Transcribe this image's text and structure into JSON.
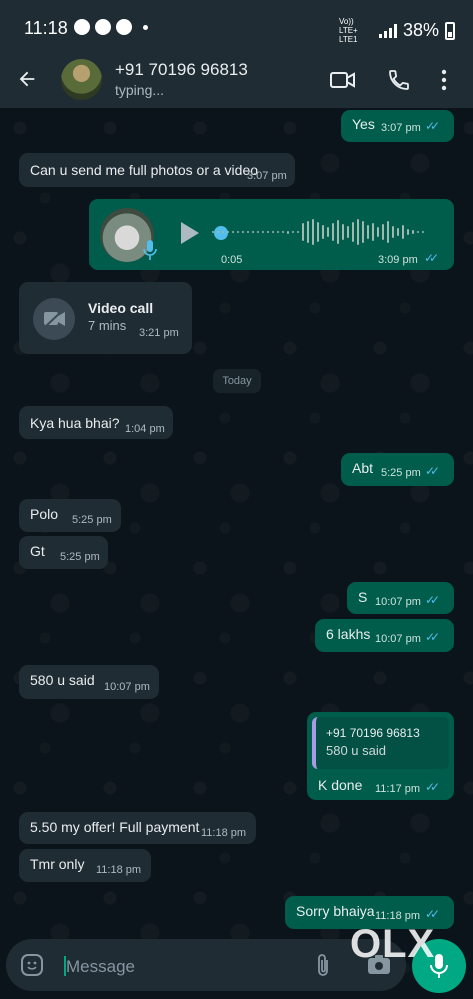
{
  "status_bar": {
    "time": "11:18",
    "network_label": "Vo)) LTE+ LTE1",
    "battery": "38%"
  },
  "header": {
    "contact_name": "+91 70196 96813",
    "status": "typing..."
  },
  "date_separator": "Today",
  "messages": [
    {
      "dir": "out",
      "text": "Yes",
      "time": "3:07 pm"
    },
    {
      "dir": "in",
      "text": "Can u send me full photos or a video",
      "time": "3:07 pm"
    },
    {
      "dir": "out",
      "type": "voice",
      "duration": "0:05",
      "time": "3:09 pm"
    },
    {
      "dir": "in",
      "type": "call",
      "title": "Video call",
      "detail": "7 mins",
      "time": "3:21 pm"
    },
    {
      "dir": "in",
      "text": "Kya hua bhai?",
      "time": "1:04 pm"
    },
    {
      "dir": "out",
      "text": "Abt",
      "time": "5:25 pm"
    },
    {
      "dir": "in",
      "text": "Polo",
      "time": "5:25 pm"
    },
    {
      "dir": "in",
      "text": "Gt",
      "time": "5:25 pm"
    },
    {
      "dir": "out",
      "text": "S",
      "time": "10:07 pm"
    },
    {
      "dir": "out",
      "text": "6 lakhs",
      "time": "10:07 pm"
    },
    {
      "dir": "in",
      "text": "580 u said",
      "time": "10:07 pm"
    },
    {
      "dir": "out",
      "type": "reply",
      "quoted_author": "+91 70196 96813",
      "quoted_text": "580 u said",
      "text": "K done",
      "time": "11:17 pm"
    },
    {
      "dir": "in",
      "text": "5.50 my offer! Full payment",
      "time": "11:18 pm"
    },
    {
      "dir": "in",
      "text": "Tmr only",
      "time": "11:18 pm"
    },
    {
      "dir": "out",
      "text": "Sorry bhaiya",
      "time": "11:18 pm"
    }
  ],
  "composer": {
    "placeholder": "Message"
  },
  "watermark": "OLX",
  "colors": {
    "incoming": "#202c33",
    "outgoing": "#005c4b",
    "accent": "#00a884",
    "read_ticks": "#53bdeb"
  },
  "icons": [
    "back-arrow-icon",
    "video-call-icon",
    "phone-icon",
    "more-icon",
    "emoji-icon",
    "attach-icon",
    "camera-icon",
    "mic-icon",
    "play-icon",
    "videocam-icon"
  ]
}
